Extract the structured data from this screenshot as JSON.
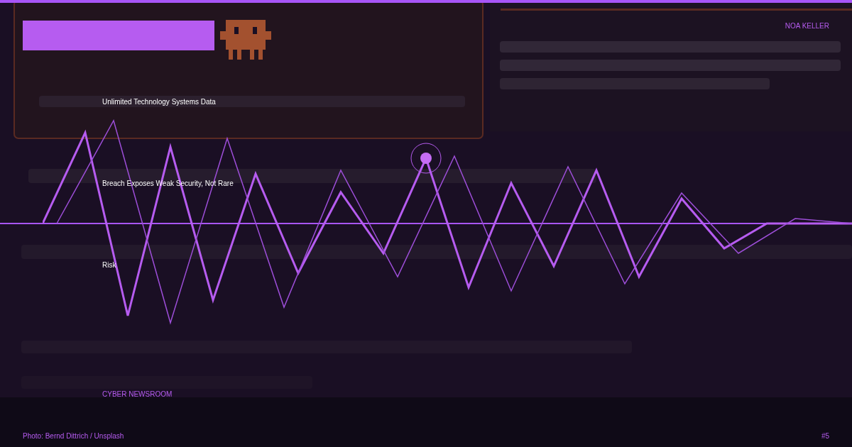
{
  "card": {
    "tagline": "Unlimited Technology Systems Data",
    "headline": "Breach Exposes Weak Security, Not Rare",
    "tag": "Risk",
    "brand": "CYBER NEWSROOM",
    "author": "NOA KELLER",
    "credit": "Photo: Bernd Dittrich / Unsplash",
    "number": "#5"
  }
}
